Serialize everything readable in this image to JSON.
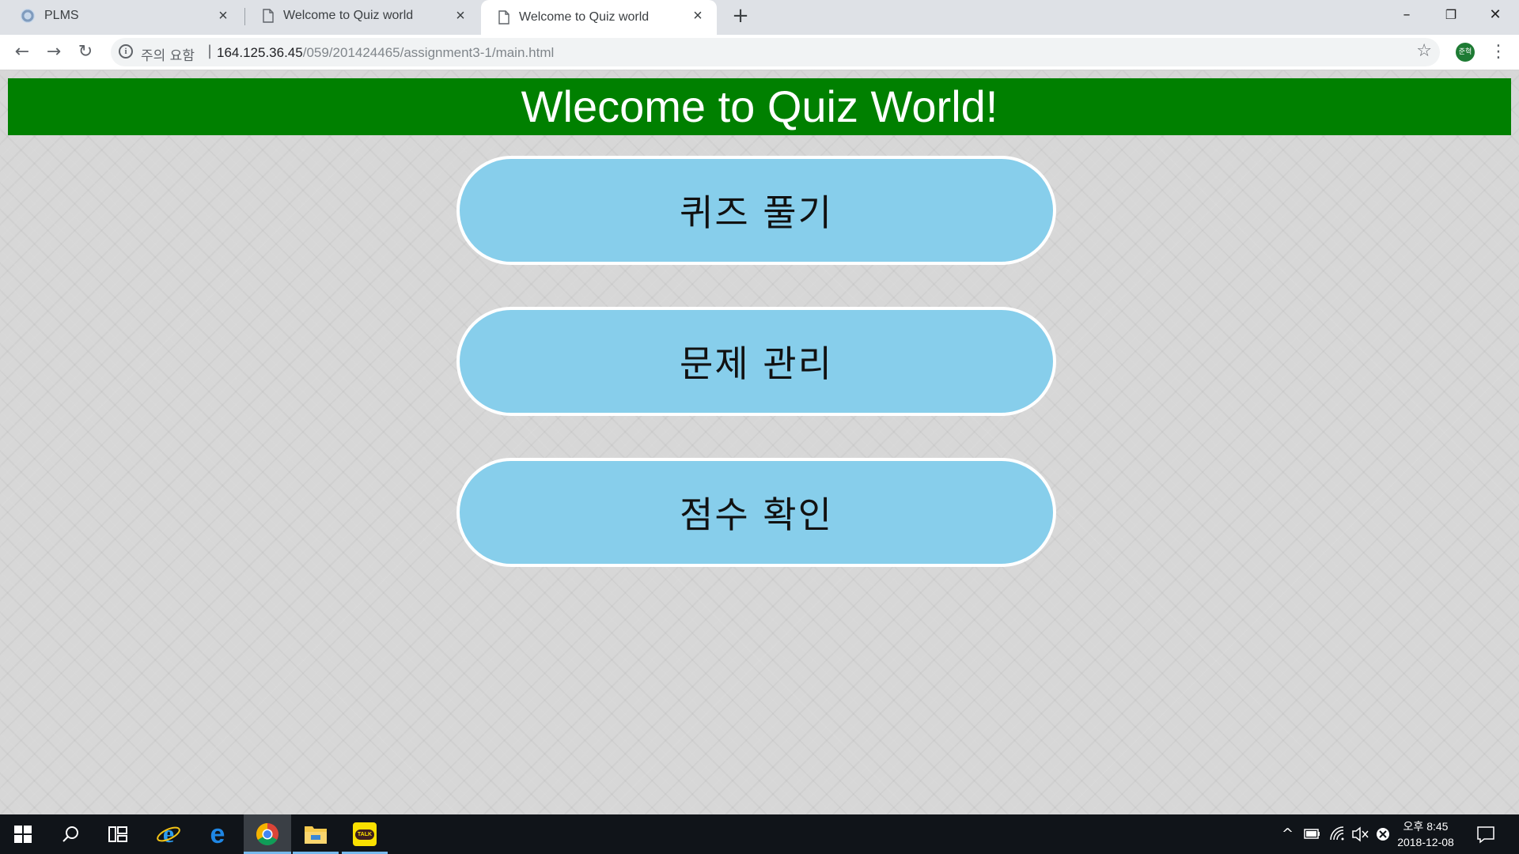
{
  "browser": {
    "tabs": [
      {
        "title": "PLMS",
        "favicon": "plms-logo-icon",
        "close": "×"
      },
      {
        "title": "Welcome to Quiz world",
        "favicon": "document-icon",
        "close": "×"
      },
      {
        "title": "Welcome to Quiz world",
        "favicon": "document-icon",
        "close": "×",
        "active": true
      }
    ],
    "new_tab": "+",
    "window_controls": {
      "minimize": "–",
      "restore": "❐",
      "close": "✕"
    },
    "nav": {
      "back": "←",
      "forward": "→",
      "reload": "↻"
    },
    "omnibox": {
      "info_icon": "i",
      "security_warning": "주의 요함",
      "separator": "|",
      "url_host": "164.125.36.45",
      "url_path": "/059/201424465/assignment3-1/main.html"
    },
    "bookmark_star": "☆",
    "profile_initials": "준혁",
    "menu": "⋮"
  },
  "page": {
    "header_title": "Wlecome to Quiz World!",
    "buttons": [
      {
        "label": "퀴즈 풀기"
      },
      {
        "label": "문제 관리"
      },
      {
        "label": "점수 확인"
      }
    ],
    "colors": {
      "header_bg": "#008000",
      "header_text": "#ffffff",
      "button_bg": "#87ceeb",
      "button_border": "#ffffff"
    }
  },
  "taskbar": {
    "start": "start-icon",
    "search": "search-icon",
    "task_view": "task-view-icon",
    "apps": [
      "internet-explorer-icon",
      "edge-icon",
      "chrome-icon",
      "file-explorer-icon",
      "kakaotalk-icon"
    ],
    "kakaotalk_label": "TALK",
    "tray": {
      "chevron": "^",
      "time": "오후 8:45",
      "date": "2018-12-08"
    }
  }
}
